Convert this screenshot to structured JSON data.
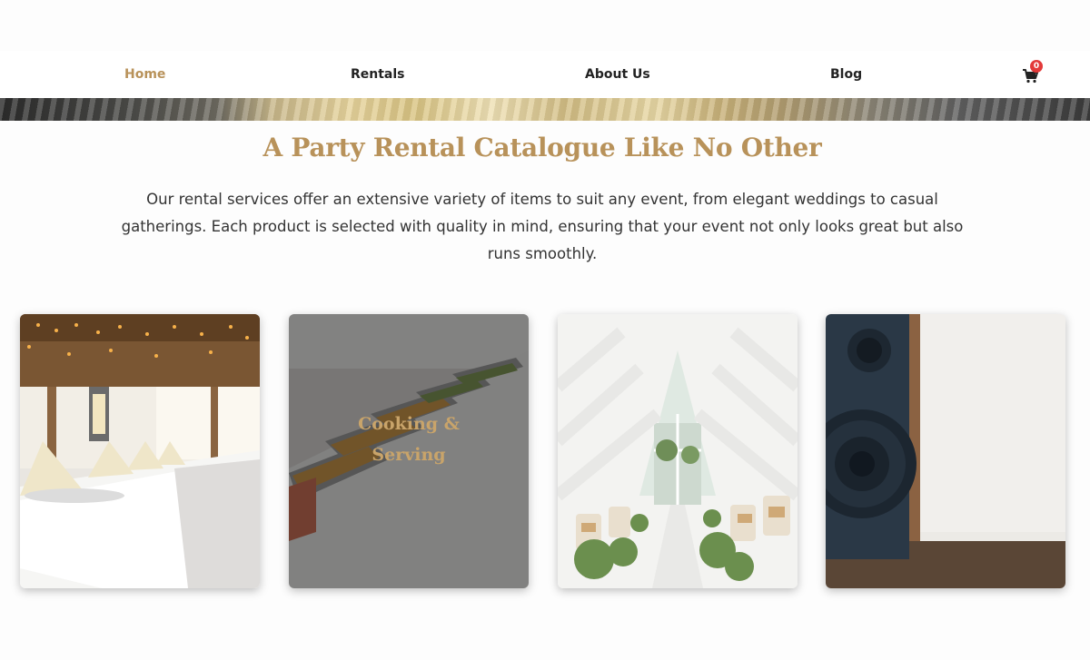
{
  "nav": {
    "items": [
      {
        "label": "Home",
        "active": true
      },
      {
        "label": "Rentals",
        "active": false
      },
      {
        "label": "About Us",
        "active": false
      },
      {
        "label": "Blog",
        "active": false
      }
    ],
    "cart_count": "0",
    "cart_icon": "shopping-cart-icon",
    "accent_color": "#b8925a",
    "badge_color": "#e33a3a"
  },
  "section": {
    "title": "A Party Rental Catalogue Like No Other",
    "body": "Our rental services offer an extensive variety of items to suit any event, from elegant weddings to casual gatherings. Each product is selected with quality in mind, ensuring that your event not only looks great but also runs smoothly."
  },
  "cards": [
    {
      "name": "tables-linens",
      "label": ""
    },
    {
      "name": "cooking-serving",
      "label_line1": "Cooking &",
      "label_line2": "Serving"
    },
    {
      "name": "ceremony",
      "label": ""
    },
    {
      "name": "audio",
      "label": ""
    }
  ]
}
